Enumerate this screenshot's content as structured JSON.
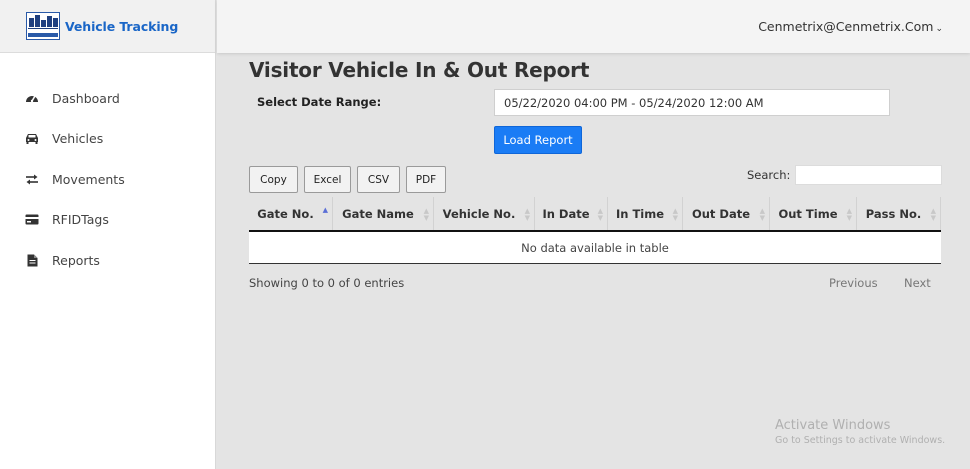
{
  "brand": {
    "title": "Vehicle Tracking",
    "accent": "#1a66c7"
  },
  "header": {
    "user": "Cenmetrix@Cenmetrix.Com",
    "caret": "⌄"
  },
  "sidebar": {
    "items": [
      {
        "label": "Dashboard",
        "icon": "dashboard-icon"
      },
      {
        "label": "Vehicles",
        "icon": "car-icon"
      },
      {
        "label": "Movements",
        "icon": "exchange-icon"
      },
      {
        "label": "RFIDTags",
        "icon": "card-icon"
      },
      {
        "label": "Reports",
        "icon": "file-icon"
      }
    ]
  },
  "main": {
    "title": "Visitor Vehicle In & Out Report",
    "date_range_label": "Select Date Range:",
    "date_range_value": "05/22/2020 04:00 PM - 05/24/2020 12:00 AM",
    "load_button": "Load Report",
    "load_button_color": "#1a7cf5",
    "export_buttons": [
      "Copy",
      "Excel",
      "CSV",
      "PDF"
    ],
    "search_label": "Search:",
    "search_value": "",
    "table": {
      "columns": [
        "Gate No.",
        "Gate Name",
        "Vehicle No.",
        "In Date",
        "In Time",
        "Out Date",
        "Out Time",
        "Pass No."
      ],
      "sorted_column": "Gate No.",
      "empty_message": "No data available in table"
    },
    "info": "Showing 0 to 0 of 0 entries",
    "pagination": {
      "previous": "Previous",
      "next": "Next"
    }
  },
  "watermark": {
    "line1": "Activate Windows",
    "line2": "Go to Settings to activate Windows."
  }
}
